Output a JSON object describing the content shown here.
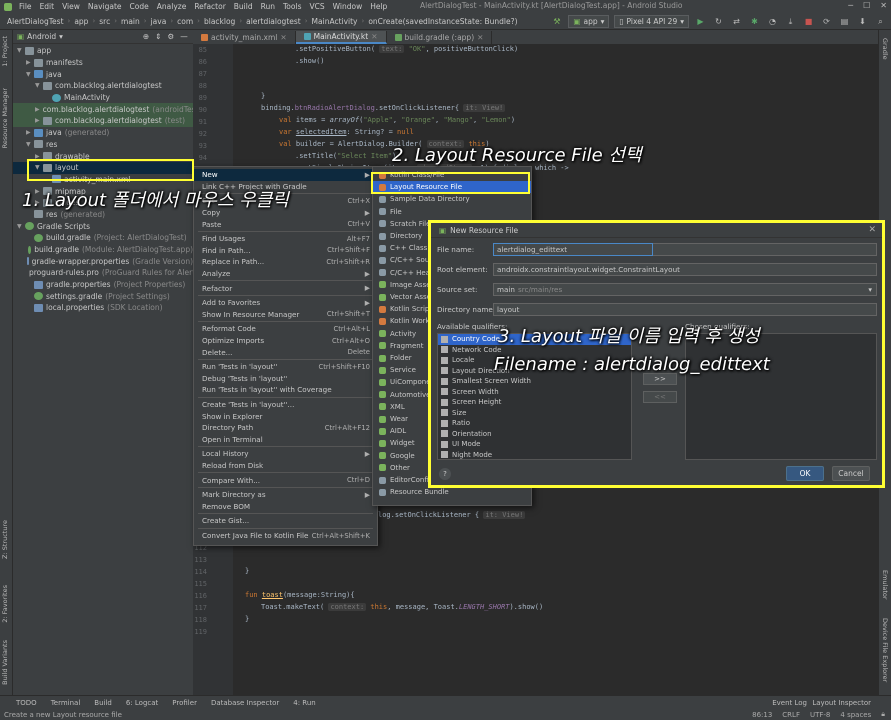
{
  "menubar": {
    "items": [
      "File",
      "Edit",
      "View",
      "Navigate",
      "Code",
      "Analyze",
      "Refactor",
      "Build",
      "Run",
      "Tools",
      "VCS",
      "Window",
      "Help"
    ],
    "title": "AlertDialogTest - MainActivity.kt [AlertDialogTest.app] - Android Studio"
  },
  "breadcrumb": [
    "AlertDialogTest",
    "app",
    "src",
    "main",
    "java",
    "com",
    "blacklog",
    "alertdialogtest",
    "MainActivity",
    "onCreate(savedInstanceState: Bundle?)"
  ],
  "toolbar": {
    "run_config": "app",
    "device": "Pixel 4 API 29"
  },
  "project_panel": {
    "view_mode": "Android",
    "tree": [
      {
        "label": "app",
        "indent": 0,
        "arrow": "▼",
        "icon": "folder",
        "note": ""
      },
      {
        "label": "manifests",
        "indent": 1,
        "arrow": "▶",
        "icon": "folder",
        "note": ""
      },
      {
        "label": "java",
        "indent": 1,
        "arrow": "▼",
        "icon": "folder-blue",
        "note": ""
      },
      {
        "label": "com.blacklog.alertdialogtest",
        "indent": 2,
        "arrow": "▼",
        "icon": "folder",
        "note": ""
      },
      {
        "label": "MainActivity",
        "indent": 3,
        "arrow": "",
        "icon": "kt",
        "note": ""
      },
      {
        "label": "com.blacklog.alertdialogtest",
        "indent": 2,
        "arrow": "▶",
        "icon": "folder",
        "note": "(androidTest)",
        "sel": "green"
      },
      {
        "label": "com.blacklog.alertdialogtest",
        "indent": 2,
        "arrow": "▶",
        "icon": "folder",
        "note": "(test)",
        "sel": "green"
      },
      {
        "label": "java",
        "indent": 1,
        "arrow": "▶",
        "icon": "folder-blue",
        "note": "(generated)"
      },
      {
        "label": "res",
        "indent": 1,
        "arrow": "▼",
        "icon": "folder",
        "note": ""
      },
      {
        "label": "drawable",
        "indent": 2,
        "arrow": "▶",
        "icon": "folder",
        "note": ""
      },
      {
        "label": "layout",
        "indent": 2,
        "arrow": "▼",
        "icon": "folder",
        "note": "",
        "sel": "blue"
      },
      {
        "label": "activity_main.xml",
        "indent": 3,
        "arrow": "",
        "icon": "file",
        "note": ""
      },
      {
        "label": "mipmap",
        "indent": 2,
        "arrow": "▶",
        "icon": "folder",
        "note": ""
      },
      {
        "label": "values",
        "indent": 2,
        "arrow": "▶",
        "icon": "folder",
        "note": ""
      },
      {
        "label": "res",
        "indent": 1,
        "arrow": "",
        "icon": "folder",
        "note": "(generated)"
      },
      {
        "label": "Gradle Scripts",
        "indent": 0,
        "arrow": "▼",
        "icon": "gradle",
        "note": ""
      },
      {
        "label": "build.gradle",
        "indent": 1,
        "arrow": "",
        "icon": "gradle",
        "note": "(Project: AlertDialogTest)"
      },
      {
        "label": "build.gradle",
        "indent": 1,
        "arrow": "",
        "icon": "gradle",
        "note": "(Module: AlertDialogTest.app)"
      },
      {
        "label": "gradle-wrapper.properties",
        "indent": 1,
        "arrow": "",
        "icon": "file",
        "note": "(Gradle Version)"
      },
      {
        "label": "proguard-rules.pro",
        "indent": 1,
        "arrow": "",
        "icon": "file",
        "note": "(ProGuard Rules for AlertD"
      },
      {
        "label": "gradle.properties",
        "indent": 1,
        "arrow": "",
        "icon": "file",
        "note": "(Project Properties)"
      },
      {
        "label": "settings.gradle",
        "indent": 1,
        "arrow": "",
        "icon": "gradle",
        "note": "(Project Settings)"
      },
      {
        "label": "local.properties",
        "indent": 1,
        "arrow": "",
        "icon": "file",
        "note": "(SDK Location)"
      }
    ]
  },
  "editor": {
    "tabs": [
      {
        "label": "activity_main.xml",
        "active": false
      },
      {
        "label": "MainActivity.kt",
        "active": true
      },
      {
        "label": "build.gradle (:app)",
        "active": false
      }
    ],
    "line_numbers": [
      "85",
      "86",
      "87",
      "88",
      "89",
      "90",
      "91",
      "92",
      "93",
      "94",
      "95",
      "96",
      "97",
      "98"
    ],
    "line_numbers_bottom": [
      "111",
      "112",
      "113",
      "114",
      "115",
      "116",
      "117",
      "118",
      "119"
    ]
  },
  "context_menu": {
    "items": [
      {
        "label": "New",
        "shortcut": "▶",
        "hl": true
      },
      {
        "label": "Link C++ Project with Gradle",
        "shortcut": ""
      },
      {
        "sep": true
      },
      {
        "label": "Cut",
        "shortcut": "Ctrl+X"
      },
      {
        "label": "Copy",
        "shortcut": "▶"
      },
      {
        "label": "Paste",
        "shortcut": "Ctrl+V"
      },
      {
        "sep": true
      },
      {
        "label": "Find Usages",
        "shortcut": "Alt+F7"
      },
      {
        "label": "Find in Path...",
        "shortcut": "Ctrl+Shift+F"
      },
      {
        "label": "Replace in Path...",
        "shortcut": "Ctrl+Shift+R"
      },
      {
        "label": "Analyze",
        "shortcut": "▶"
      },
      {
        "sep": true
      },
      {
        "label": "Refactor",
        "shortcut": "▶"
      },
      {
        "sep": true
      },
      {
        "label": "Add to Favorites",
        "shortcut": "▶"
      },
      {
        "label": "Show In Resource Manager",
        "shortcut": "Ctrl+Shift+T"
      },
      {
        "sep": true
      },
      {
        "label": "Reformat Code",
        "shortcut": "Ctrl+Alt+L"
      },
      {
        "label": "Optimize Imports",
        "shortcut": "Ctrl+Alt+O"
      },
      {
        "label": "Delete...",
        "shortcut": "Delete"
      },
      {
        "sep": true
      },
      {
        "label": "Run 'Tests in 'layout''",
        "shortcut": "Ctrl+Shift+F10"
      },
      {
        "label": "Debug 'Tests in 'layout''",
        "shortcut": ""
      },
      {
        "label": "Run 'Tests in 'layout'' with Coverage",
        "shortcut": ""
      },
      {
        "sep": true
      },
      {
        "label": "Create 'Tests in 'layout''...",
        "shortcut": ""
      },
      {
        "label": "Show in Explorer",
        "shortcut": ""
      },
      {
        "label": "Directory Path",
        "shortcut": "Ctrl+Alt+F12"
      },
      {
        "label": "Open in Terminal",
        "shortcut": ""
      },
      {
        "sep": true
      },
      {
        "label": "Local History",
        "shortcut": "▶"
      },
      {
        "label": "Reload from Disk",
        "shortcut": ""
      },
      {
        "sep": true
      },
      {
        "label": "Compare With...",
        "shortcut": "Ctrl+D"
      },
      {
        "sep": true
      },
      {
        "label": "Mark Directory as",
        "shortcut": "▶"
      },
      {
        "label": "Remove BOM",
        "shortcut": ""
      },
      {
        "sep": true
      },
      {
        "label": "Create Gist...",
        "shortcut": ""
      },
      {
        "sep": true
      },
      {
        "label": "Convert Java File to Kotlin File",
        "shortcut": "Ctrl+Alt+Shift+K"
      }
    ]
  },
  "sub_menu": {
    "items": [
      {
        "label": "Kotlin Class/File",
        "icon": "orange"
      },
      {
        "label": "Layout Resource File",
        "icon": "orange",
        "hl": true
      },
      {
        "label": "Sample Data Directory",
        "icon": "grey"
      },
      {
        "label": "File",
        "icon": "grey"
      },
      {
        "label": "Scratch File",
        "icon": "grey"
      },
      {
        "label": "Directory",
        "icon": "grey"
      },
      {
        "label": "C++ Class",
        "icon": "grey"
      },
      {
        "label": "C/C++ Source",
        "icon": "grey"
      },
      {
        "label": "C/C++ Header",
        "icon": "grey"
      },
      {
        "label": "Image Asset",
        "icon": ""
      },
      {
        "label": "Vector Asset",
        "icon": ""
      },
      {
        "label": "Kotlin Script",
        "icon": "orange"
      },
      {
        "label": "Kotlin Worksheet",
        "icon": "orange"
      },
      {
        "label": "Activity",
        "icon": ""
      },
      {
        "label": "Fragment",
        "icon": ""
      },
      {
        "label": "Folder",
        "icon": ""
      },
      {
        "label": "Service",
        "icon": ""
      },
      {
        "label": "UiComponent",
        "icon": ""
      },
      {
        "label": "Automotive",
        "icon": ""
      },
      {
        "label": "XML",
        "icon": ""
      },
      {
        "label": "Wear",
        "icon": ""
      },
      {
        "label": "AIDL",
        "icon": ""
      },
      {
        "label": "Widget",
        "icon": ""
      },
      {
        "label": "Google",
        "icon": ""
      },
      {
        "label": "Other",
        "icon": ""
      },
      {
        "label": "EditorConfig File",
        "icon": "grey"
      },
      {
        "label": "Resource Bundle",
        "icon": "grey"
      }
    ]
  },
  "dialog": {
    "title": "New Resource File",
    "file_name_label": "File name:",
    "file_name_value": "alertdialog_edittext",
    "root_element_label": "Root element:",
    "root_element_value": "androidx.constraintlayout.widget.ConstraintLayout",
    "source_set_label": "Source set:",
    "source_set_value": "main",
    "source_set_path": "src/main/res",
    "directory_label": "Directory name:",
    "directory_value": "layout",
    "available_label": "Available qualifiers:",
    "chosen_label": "Chosen qualifiers:",
    "qualifiers": [
      "Country Code",
      "Network Code",
      "Locale",
      "Layout Direction",
      "Smallest Screen Width",
      "Screen Width",
      "Screen Height",
      "Size",
      "Ratio",
      "Orientation",
      "UI Mode",
      "Night Mode"
    ],
    "ok": "OK",
    "cancel": "Cancel",
    "help": "?"
  },
  "bottom_tools": [
    "TODO",
    "Terminal",
    "Build",
    "6: Logcat",
    "Profiler",
    "Database Inspector",
    "4: Run"
  ],
  "bottom_tools_right": [
    "Event Log",
    "Layout Inspector"
  ],
  "status": {
    "message": "Create a new Layout resource file",
    "position": "86:13",
    "line_sep": "CRLF",
    "encoding": "UTF-8",
    "indent": "4 spaces"
  },
  "left_strip_tabs": [
    "1: Project",
    "Resource Manager",
    "Z: Structure",
    "2: Favorites",
    "Build Variants"
  ],
  "right_strip_tabs": [
    "Gradle",
    "Emulator",
    "Device File Explorer"
  ],
  "annotations": {
    "step1": "1. Layout 폴더에서 마우스 우클릭",
    "step2": "2. Layout Resource File 선택",
    "step3_line1": "3. Layout 파일 이름 입력 후 생성",
    "step3_line2": "Filename : alertdialog_edittext"
  },
  "colors": {
    "highlight": "#ffff33",
    "selection": "#2f65ca",
    "background": "#2b2b2b",
    "panel": "#3c3f41"
  }
}
